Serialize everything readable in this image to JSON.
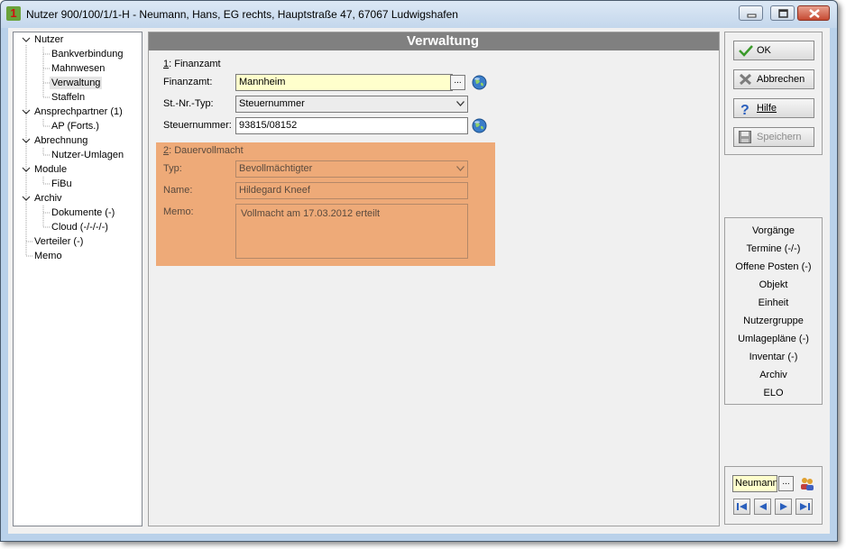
{
  "window": {
    "title": "Nutzer 900/100/1/1-H - Neumann, Hans, EG rechts, Hauptstraße 47, 67067 Ludwigshafen",
    "icon_text": "1",
    "controls": [
      "minimize-icon",
      "maximize-icon",
      "close-icon"
    ]
  },
  "tree": {
    "items": [
      {
        "label": "Nutzer",
        "level": 0,
        "expandable": true
      },
      {
        "label": "Bankverbindung",
        "level": 1
      },
      {
        "label": "Mahnwesen",
        "level": 1
      },
      {
        "label": "Verwaltung",
        "level": 1,
        "selected": true
      },
      {
        "label": "Staffeln",
        "level": 1
      },
      {
        "label": "Ansprechpartner (1)",
        "level": 0,
        "expandable": true
      },
      {
        "label": "AP (Forts.)",
        "level": 1
      },
      {
        "label": "Abrechnung",
        "level": 0,
        "expandable": true
      },
      {
        "label": "Nutzer-Umlagen",
        "level": 1
      },
      {
        "label": "Module",
        "level": 0,
        "expandable": true
      },
      {
        "label": "FiBu",
        "level": 1
      },
      {
        "label": "Archiv",
        "level": 0,
        "expandable": true
      },
      {
        "label": "Dokumente (-)",
        "level": 1
      },
      {
        "label": "Cloud (-/-/-/-)",
        "level": 1
      },
      {
        "label": "Verteiler (-)",
        "level": 0
      },
      {
        "label": "Memo",
        "level": 0
      }
    ]
  },
  "content": {
    "header": "Verwaltung",
    "finanzamt": {
      "group_hotkey": "1",
      "group_title": ": Finanzamt",
      "finanzamt_label": "Finanzamt:",
      "finanzamt_value": "Mannheim",
      "stnr_typ_label": "St.-Nr.-Typ:",
      "stnr_typ_value": "Steuernummer",
      "steuernummer_label": "Steuernummer:",
      "steuernummer_value": "93815/08152",
      "dots_label": "..."
    },
    "dauervollmacht": {
      "group_hotkey": "2",
      "group_title": ": Dauervollmacht",
      "typ_label": "Typ:",
      "typ_value": "Bevollmächtigter",
      "name_label": "Name:",
      "name_value": "Hildegard Kneef",
      "memo_label": "Memo:",
      "memo_value": "Vollmacht am 17.03.2012 erteilt",
      "background_color": "#eeaa78"
    }
  },
  "actions": {
    "ok": "OK",
    "abbrechen": "Abbrechen",
    "hilfe": "Hilfe",
    "speichern": "Speichern"
  },
  "navigation": {
    "items": [
      "Vorgänge",
      "Termine (-/-)",
      "Offene Posten (-)",
      "Objekt",
      "Einheit",
      "Nutzergruppe",
      "Umlagepläne (-)",
      "Inventar (-)",
      "Archiv",
      "ELO"
    ]
  },
  "record_nav": {
    "search_value": "Neumann",
    "dots_label": "..."
  },
  "colors": {
    "header_bg": "#808080",
    "finanzamt_field_bg": "#ffffcc",
    "window_frame": "#b9d1ea"
  }
}
